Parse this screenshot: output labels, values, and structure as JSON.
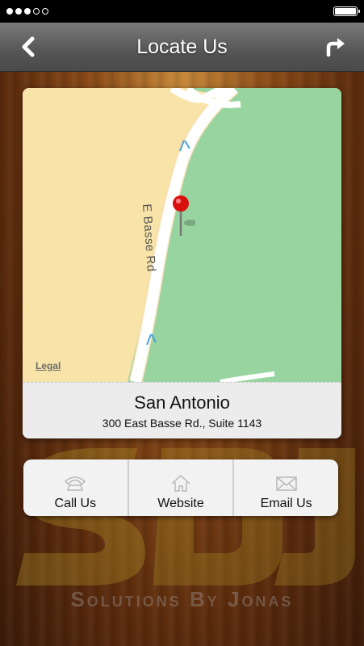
{
  "status_bar": {
    "signal_dots_filled": 3,
    "signal_dots_total": 5,
    "battery_level": 1.0
  },
  "nav": {
    "title": "Locate Us",
    "back_icon": "chevron-left-icon",
    "share_icon": "share-arrow-icon"
  },
  "map": {
    "legal_label": "Legal",
    "street_label": "E Basse Rd"
  },
  "location": {
    "city": "San Antonio",
    "address": "300 East Basse Rd., Suite 1143"
  },
  "actions": [
    {
      "label": "Call Us",
      "icon": "phone-icon"
    },
    {
      "label": "Website",
      "icon": "home-icon"
    },
    {
      "label": "Email Us",
      "icon": "envelope-icon"
    }
  ],
  "branding": {
    "logo_text": "Solutions By Jonas"
  },
  "colors": {
    "map_land": "#f8e3a8",
    "map_park": "#98d4a0",
    "pin_red": "#d81010"
  }
}
